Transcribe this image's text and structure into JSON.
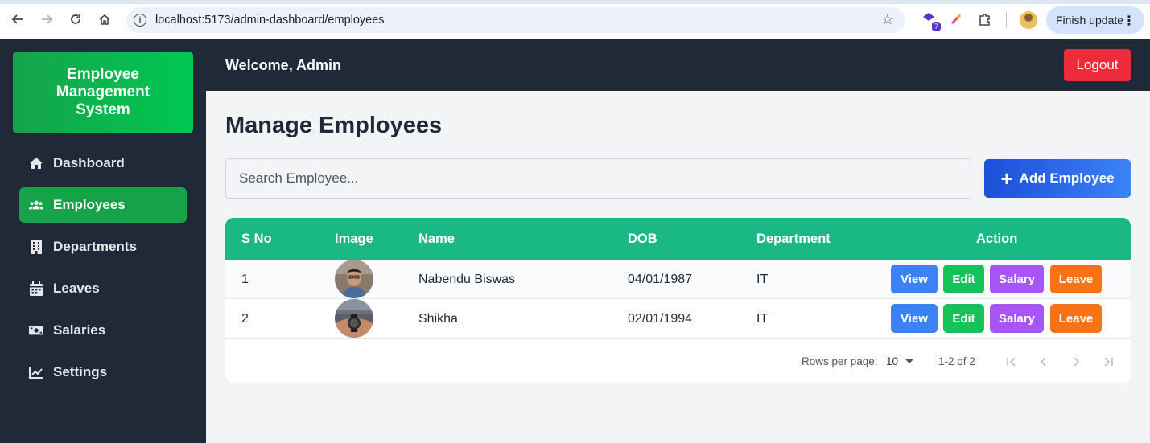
{
  "browser": {
    "url": "localhost:5173/admin-dashboard/employees",
    "extension_badge": "7",
    "finish_update_label": "Finish update"
  },
  "sidebar": {
    "brand": "Employee Management System",
    "items": [
      {
        "label": "Dashboard",
        "icon": "home-icon"
      },
      {
        "label": "Employees",
        "icon": "users-icon",
        "active": true
      },
      {
        "label": "Departments",
        "icon": "building-icon"
      },
      {
        "label": "Leaves",
        "icon": "calendar-icon"
      },
      {
        "label": "Salaries",
        "icon": "money-icon"
      },
      {
        "label": "Settings",
        "icon": "chart-line-icon"
      }
    ]
  },
  "header": {
    "welcome": "Welcome, Admin",
    "logout_label": "Logout"
  },
  "main": {
    "title": "Manage Employees",
    "search_placeholder": "Search Employee...",
    "add_button_label": "Add Employee"
  },
  "table": {
    "columns": [
      "S No",
      "Image",
      "Name",
      "DOB",
      "Department",
      "Action"
    ],
    "rows": [
      {
        "sno": "1",
        "name": "Nabendu Biswas",
        "dob": "04/01/1987",
        "department": "IT"
      },
      {
        "sno": "2",
        "name": "Shikha",
        "dob": "02/01/1994",
        "department": "IT"
      }
    ],
    "actions": {
      "view": "View",
      "edit": "Edit",
      "salary": "Salary",
      "leave": "Leave"
    }
  },
  "pagination": {
    "rows_per_page_label": "Rows per page:",
    "rows_per_page": "10",
    "range": "1-2 of 2"
  },
  "colors": {
    "sidebar_bg": "#1f2937",
    "active_green": "#16a34a",
    "table_header": "#1ab884",
    "view": "#3b82f6",
    "edit": "#16c15a",
    "salary": "#a855f7",
    "leave": "#f97316",
    "logout": "#ef2a3a"
  }
}
